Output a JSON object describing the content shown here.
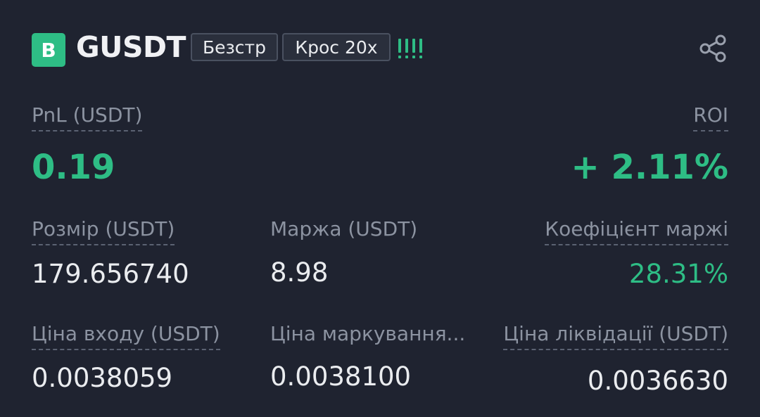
{
  "header": {
    "side_badge": "B",
    "symbol": "GUSDT",
    "mode_tag": "Безстр",
    "margin_tag": "Крос 20х",
    "risk_level": 4,
    "share_icon": "share-icon"
  },
  "pnl": {
    "label": "PnL (USDT)",
    "value": "0.19"
  },
  "roi": {
    "label": "ROI",
    "value": "+ 2.11%"
  },
  "size": {
    "label": "Розмір (USDT)",
    "value": "179.656740"
  },
  "margin": {
    "label": "Маржа (USDT)",
    "value": "8.98"
  },
  "margin_ratio": {
    "label": "Коефіцієнт маржі",
    "value": "28.31%"
  },
  "entry_price": {
    "label": "Ціна входу (USDT)",
    "value": "0.0038059"
  },
  "mark_price": {
    "label": "Ціна маркування...",
    "value": "0.0038100"
  },
  "liq_price": {
    "label": "Ціна ліквідації (USDT)",
    "value": "0.0036630"
  },
  "colors": {
    "background": "#1f2330",
    "positive": "#2ebd85",
    "label": "#8c93a1",
    "text": "#eaecef"
  }
}
